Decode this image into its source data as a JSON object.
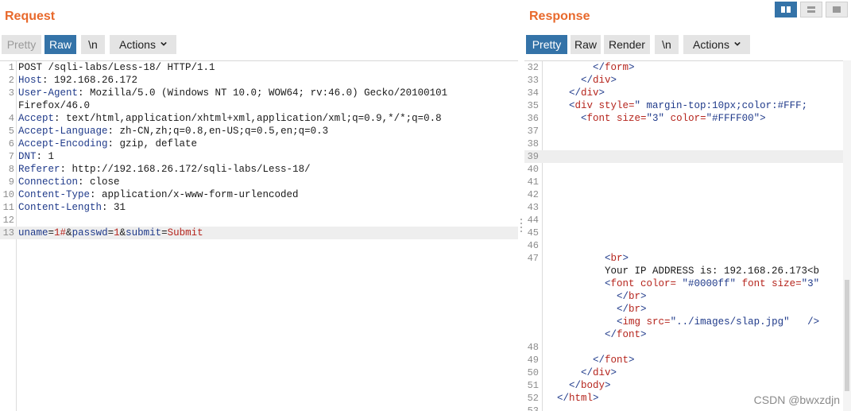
{
  "request": {
    "title": "Request",
    "tabs": {
      "pretty": "Pretty",
      "raw": "Raw",
      "newline": "\\n",
      "actions": "Actions"
    },
    "active_tab": "Raw",
    "lines": [
      {
        "n": "1",
        "parts": [
          {
            "t": "POST /sqli-labs/Less-18/ HTTP/1.1",
            "c": ""
          }
        ]
      },
      {
        "n": "2",
        "parts": [
          {
            "t": "Host",
            "c": "key"
          },
          {
            "t": ": 192.168.26.172",
            "c": ""
          }
        ]
      },
      {
        "n": "3",
        "parts": [
          {
            "t": "User-Agent",
            "c": "key"
          },
          {
            "t": ": Mozilla/5.0 (Windows NT 10.0; WOW64; rv:46.0) Gecko/20100101",
            "c": ""
          }
        ]
      },
      {
        "n": "",
        "parts": [
          {
            "t": "Firefox/46.0",
            "c": ""
          }
        ]
      },
      {
        "n": "4",
        "parts": [
          {
            "t": "Accept",
            "c": "key"
          },
          {
            "t": ": text/html,application/xhtml+xml,application/xml;q=0.9,*/*;q=0.8",
            "c": ""
          }
        ]
      },
      {
        "n": "5",
        "parts": [
          {
            "t": "Accept-Language",
            "c": "key"
          },
          {
            "t": ": zh-CN,zh;q=0.8,en-US;q=0.5,en;q=0.3",
            "c": ""
          }
        ]
      },
      {
        "n": "6",
        "parts": [
          {
            "t": "Accept-Encoding",
            "c": "key"
          },
          {
            "t": ": gzip, deflate",
            "c": ""
          }
        ]
      },
      {
        "n": "7",
        "parts": [
          {
            "t": "DNT",
            "c": "key"
          },
          {
            "t": ": 1",
            "c": ""
          }
        ]
      },
      {
        "n": "8",
        "parts": [
          {
            "t": "Referer",
            "c": "key"
          },
          {
            "t": ": http://192.168.26.172/sqli-labs/Less-18/",
            "c": ""
          }
        ]
      },
      {
        "n": "9",
        "parts": [
          {
            "t": "Connection",
            "c": "key"
          },
          {
            "t": ": close",
            "c": ""
          }
        ]
      },
      {
        "n": "10",
        "parts": [
          {
            "t": "Content-Type",
            "c": "key"
          },
          {
            "t": ": application/x-www-form-urlencoded",
            "c": ""
          }
        ]
      },
      {
        "n": "11",
        "parts": [
          {
            "t": "Content-Length",
            "c": "key"
          },
          {
            "t": ": 31",
            "c": ""
          }
        ]
      },
      {
        "n": "12",
        "parts": [
          {
            "t": "",
            "c": ""
          }
        ]
      },
      {
        "n": "13",
        "hl": true,
        "parts": [
          {
            "t": "uname",
            "c": "key"
          },
          {
            "t": "=",
            "c": ""
          },
          {
            "t": "1#",
            "c": "pv"
          },
          {
            "t": "&",
            "c": ""
          },
          {
            "t": "passwd",
            "c": "key"
          },
          {
            "t": "=",
            "c": ""
          },
          {
            "t": "1",
            "c": "pv"
          },
          {
            "t": "&",
            "c": ""
          },
          {
            "t": "submit",
            "c": "key"
          },
          {
            "t": "=",
            "c": ""
          },
          {
            "t": "Submit",
            "c": "pv"
          }
        ]
      }
    ]
  },
  "response": {
    "title": "Response",
    "tabs": {
      "pretty": "Pretty",
      "raw": "Raw",
      "render": "Render",
      "newline": "\\n",
      "actions": "Actions"
    },
    "active_tab": "Pretty",
    "lines": [
      {
        "n": "32",
        "parts": [
          {
            "t": "        </",
            "c": "tag"
          },
          {
            "t": "form",
            "c": "attr"
          },
          {
            "t": ">",
            "c": "tag"
          }
        ]
      },
      {
        "n": "33",
        "parts": [
          {
            "t": "      </",
            "c": "tag"
          },
          {
            "t": "div",
            "c": "attr"
          },
          {
            "t": ">",
            "c": "tag"
          }
        ]
      },
      {
        "n": "34",
        "parts": [
          {
            "t": "    </",
            "c": "tag"
          },
          {
            "t": "div",
            "c": "attr"
          },
          {
            "t": ">",
            "c": "tag"
          }
        ]
      },
      {
        "n": "35",
        "parts": [
          {
            "t": "    <",
            "c": "tag"
          },
          {
            "t": "div",
            "c": "attr"
          },
          {
            "t": " style=",
            "c": "attr"
          },
          {
            "t": "\" margin-top:10px;color:#FFF;",
            "c": "str"
          }
        ]
      },
      {
        "n": "36",
        "parts": [
          {
            "t": "      <",
            "c": "tag"
          },
          {
            "t": "font",
            "c": "attr"
          },
          {
            "t": " size=",
            "c": "attr"
          },
          {
            "t": "\"3\"",
            "c": "str"
          },
          {
            "t": " color=",
            "c": "attr"
          },
          {
            "t": "\"#FFFF00\"",
            "c": "str"
          },
          {
            "t": ">",
            "c": "tag"
          }
        ]
      },
      {
        "n": "37",
        "parts": [
          {
            "t": "",
            "c": ""
          }
        ]
      },
      {
        "n": "38",
        "parts": [
          {
            "t": "",
            "c": ""
          }
        ]
      },
      {
        "n": "39",
        "hl": true,
        "parts": [
          {
            "t": "",
            "c": ""
          }
        ]
      },
      {
        "n": "40",
        "parts": [
          {
            "t": "",
            "c": ""
          }
        ]
      },
      {
        "n": "41",
        "parts": [
          {
            "t": "",
            "c": ""
          }
        ]
      },
      {
        "n": "42",
        "parts": [
          {
            "t": "",
            "c": ""
          }
        ]
      },
      {
        "n": "43",
        "parts": [
          {
            "t": "",
            "c": ""
          }
        ]
      },
      {
        "n": "44",
        "parts": [
          {
            "t": "",
            "c": ""
          }
        ]
      },
      {
        "n": "45",
        "parts": [
          {
            "t": "",
            "c": ""
          }
        ]
      },
      {
        "n": "46",
        "parts": [
          {
            "t": "",
            "c": ""
          }
        ]
      },
      {
        "n": "47",
        "parts": [
          {
            "t": "          <",
            "c": "tag"
          },
          {
            "t": "br",
            "c": "attr"
          },
          {
            "t": ">",
            "c": "tag"
          }
        ]
      },
      {
        "n": "",
        "parts": [
          {
            "t": "          Your IP ADDRESS is: 192.168.26.173<b",
            "c": ""
          }
        ]
      },
      {
        "n": "",
        "parts": [
          {
            "t": "          <",
            "c": "tag"
          },
          {
            "t": "font",
            "c": "attr"
          },
          {
            "t": " color=",
            "c": "attr"
          },
          {
            "t": " \"#0000ff\"",
            "c": "str"
          },
          {
            "t": " font size=",
            "c": "attr"
          },
          {
            "t": "\"3\"",
            "c": "str"
          }
        ]
      },
      {
        "n": "",
        "parts": [
          {
            "t": "            </",
            "c": "tag"
          },
          {
            "t": "br",
            "c": "attr"
          },
          {
            "t": ">",
            "c": "tag"
          }
        ]
      },
      {
        "n": "",
        "parts": [
          {
            "t": "            </",
            "c": "tag"
          },
          {
            "t": "br",
            "c": "attr"
          },
          {
            "t": ">",
            "c": "tag"
          }
        ]
      },
      {
        "n": "",
        "parts": [
          {
            "t": "            <",
            "c": "tag"
          },
          {
            "t": "img",
            "c": "attr"
          },
          {
            "t": " src=",
            "c": "attr"
          },
          {
            "t": "\"../images/slap.jpg\"",
            "c": "str"
          },
          {
            "t": "   />",
            "c": "tag"
          }
        ]
      },
      {
        "n": "",
        "parts": [
          {
            "t": "          </",
            "c": "tag"
          },
          {
            "t": "font",
            "c": "attr"
          },
          {
            "t": ">",
            "c": "tag"
          }
        ]
      },
      {
        "n": "48",
        "parts": [
          {
            "t": "",
            "c": ""
          }
        ]
      },
      {
        "n": "49",
        "parts": [
          {
            "t": "        </",
            "c": "tag"
          },
          {
            "t": "font",
            "c": "attr"
          },
          {
            "t": ">",
            "c": "tag"
          }
        ]
      },
      {
        "n": "50",
        "parts": [
          {
            "t": "      </",
            "c": "tag"
          },
          {
            "t": "div",
            "c": "attr"
          },
          {
            "t": ">",
            "c": "tag"
          }
        ]
      },
      {
        "n": "51",
        "parts": [
          {
            "t": "    </",
            "c": "tag"
          },
          {
            "t": "body",
            "c": "attr"
          },
          {
            "t": ">",
            "c": "tag"
          }
        ]
      },
      {
        "n": "52",
        "parts": [
          {
            "t": "  </",
            "c": "tag"
          },
          {
            "t": "html",
            "c": "attr"
          },
          {
            "t": ">",
            "c": "tag"
          }
        ]
      },
      {
        "n": "53",
        "parts": [
          {
            "t": "",
            "c": ""
          }
        ]
      }
    ]
  },
  "watermark": "CSDN @bwxzdjn",
  "colors": {
    "accent": "#3473a8",
    "title": "#e8692c",
    "key": "#1f3a8a",
    "value": "#b5241c"
  },
  "layout_icons": [
    "split-horizontal-icon",
    "split-vertical-icon",
    "single-pane-icon"
  ]
}
